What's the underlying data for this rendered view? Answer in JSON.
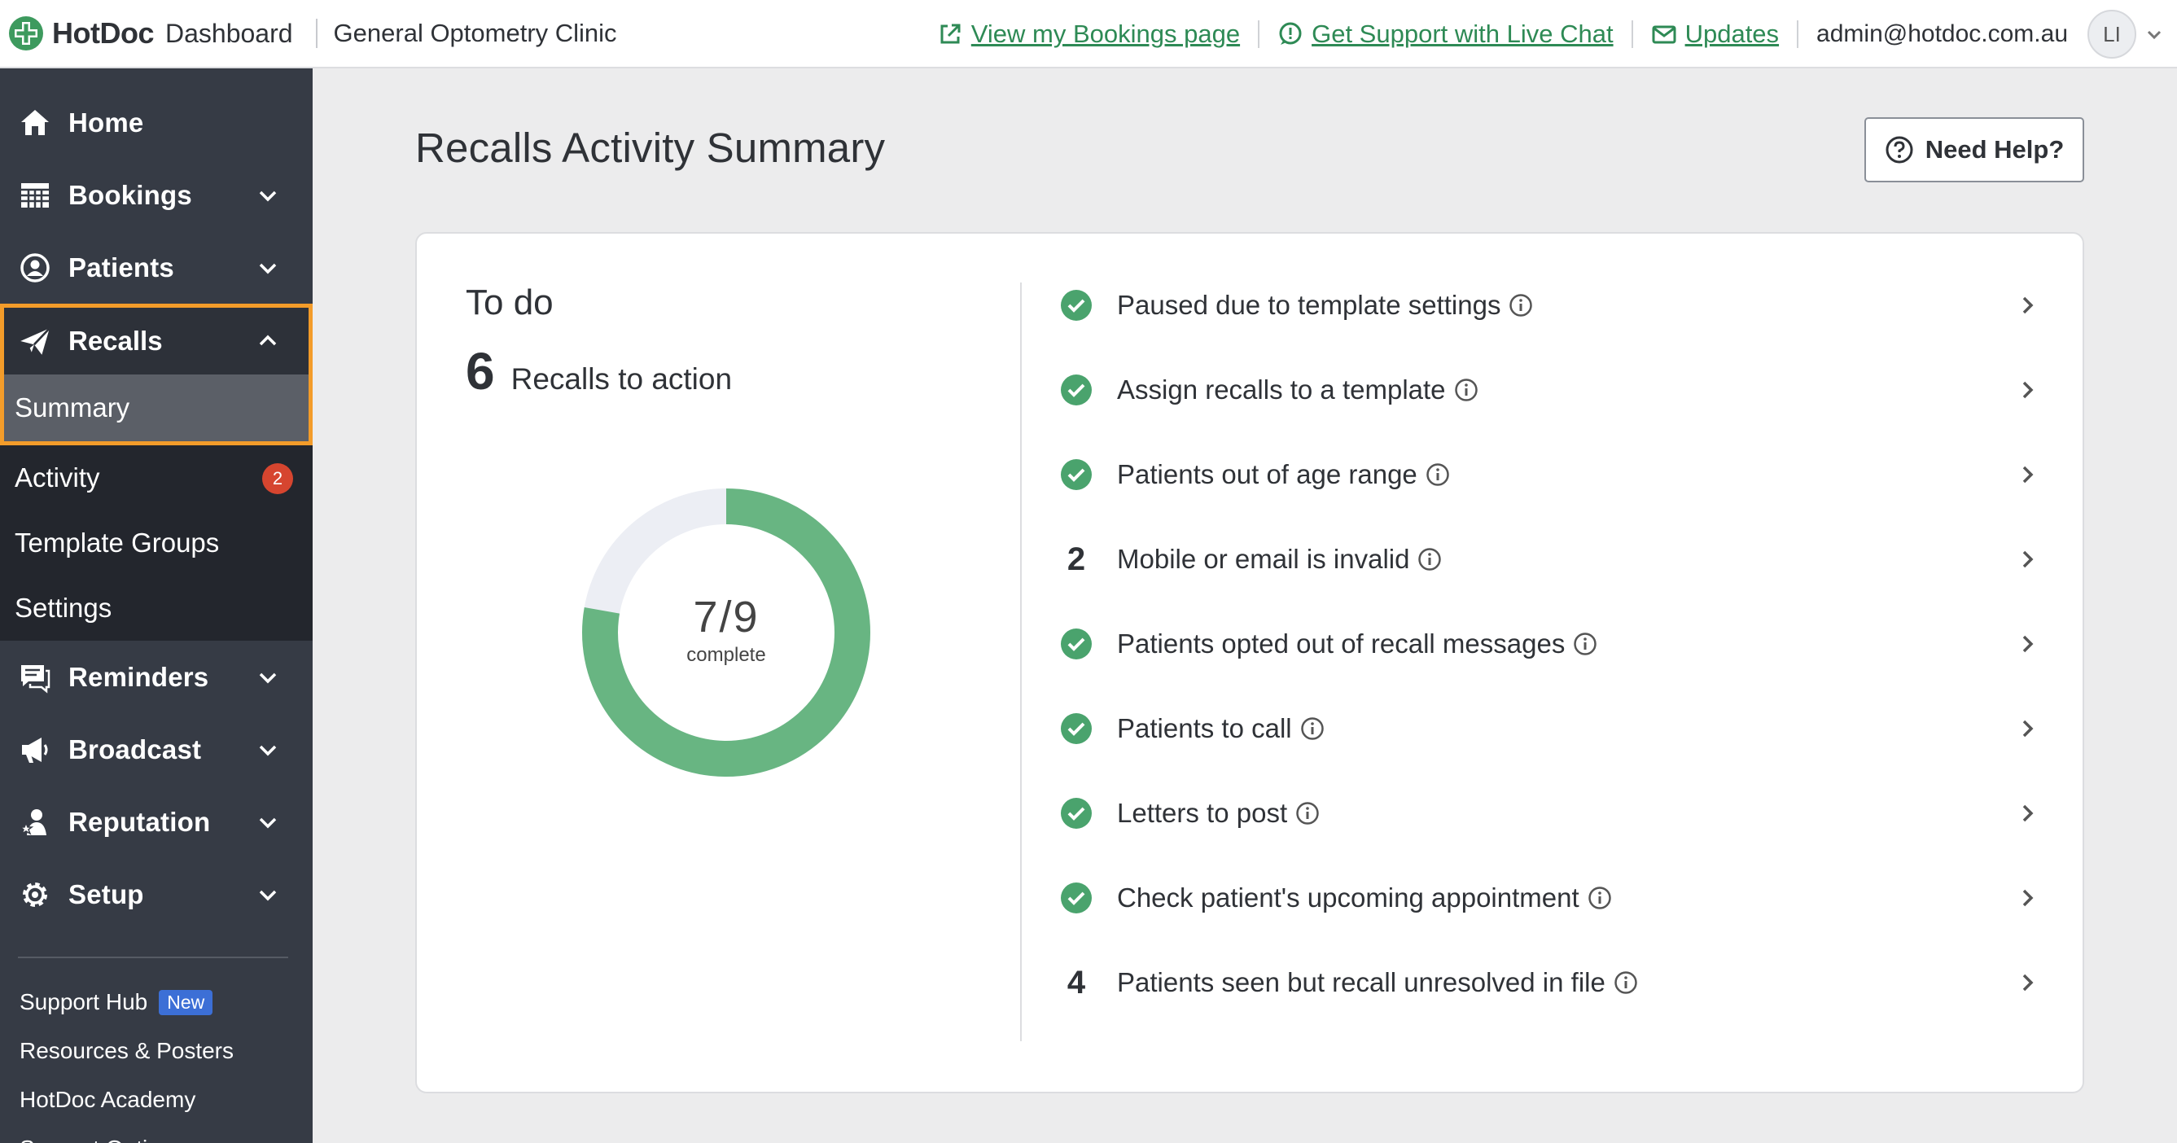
{
  "header": {
    "brand": "HotDoc",
    "section": "Dashboard",
    "clinic": "General Optometry Clinic",
    "links": [
      {
        "label": "View my Bookings page",
        "icon": "external-link-icon"
      },
      {
        "label": "Get Support with Live Chat",
        "icon": "chat-bubble-icon"
      },
      {
        "label": "Updates",
        "icon": "mail-icon"
      }
    ],
    "email": "admin@hotdoc.com.au",
    "avatar": "LI"
  },
  "sidebar": {
    "items_top": [
      {
        "label": "Home",
        "icon": "home-icon"
      },
      {
        "label": "Bookings",
        "icon": "calendar-grid-icon"
      },
      {
        "label": "Patients",
        "icon": "user-circle-icon"
      }
    ],
    "recalls": {
      "label": "Recalls",
      "icon": "paper-plane-icon",
      "active_sub": "Summary",
      "subitems": [
        {
          "label": "Activity",
          "badge": "2"
        },
        {
          "label": "Template Groups"
        },
        {
          "label": "Settings"
        }
      ]
    },
    "items_bottom": [
      {
        "label": "Reminders",
        "icon": "chat-icon"
      },
      {
        "label": "Broadcast",
        "icon": "megaphone-icon"
      },
      {
        "label": "Reputation",
        "icon": "user-star-icon"
      },
      {
        "label": "Setup",
        "icon": "gear-icon"
      }
    ],
    "footer": {
      "support_hub": "Support Hub",
      "new_badge": "New",
      "resources": "Resources & Posters",
      "academy": "HotDoc Academy",
      "support_options": "Support Options"
    }
  },
  "main": {
    "title": "Recalls Activity Summary",
    "help_button": "Need Help?",
    "todo": {
      "title": "To do",
      "count": "6",
      "count_label": "Recalls to action",
      "progress_text": "7/9",
      "progress_sub": "complete",
      "completed": 7,
      "total": 9
    },
    "tasks": [
      {
        "label": "Paused due to template settings",
        "status": "done",
        "count": ""
      },
      {
        "label": "Assign recalls to a template",
        "status": "done",
        "count": ""
      },
      {
        "label": "Patients out of age range",
        "status": "done",
        "count": ""
      },
      {
        "label": "Mobile or email is invalid",
        "status": "count",
        "count": "2"
      },
      {
        "label": "Patients opted out of recall messages",
        "status": "done",
        "count": ""
      },
      {
        "label": "Patients to call",
        "status": "done",
        "count": ""
      },
      {
        "label": "Letters to post",
        "status": "done",
        "count": ""
      },
      {
        "label": "Check patient's upcoming appointment",
        "status": "done",
        "count": ""
      },
      {
        "label": "Patients seen but recall unresolved in file",
        "status": "count",
        "count": "4"
      }
    ]
  },
  "colors": {
    "accent_green": "#68b582",
    "link_green": "#2e8a55",
    "sidebar_bg": "#363b45",
    "highlight_orange": "#f39c2a",
    "badge_red": "#d6452f"
  }
}
